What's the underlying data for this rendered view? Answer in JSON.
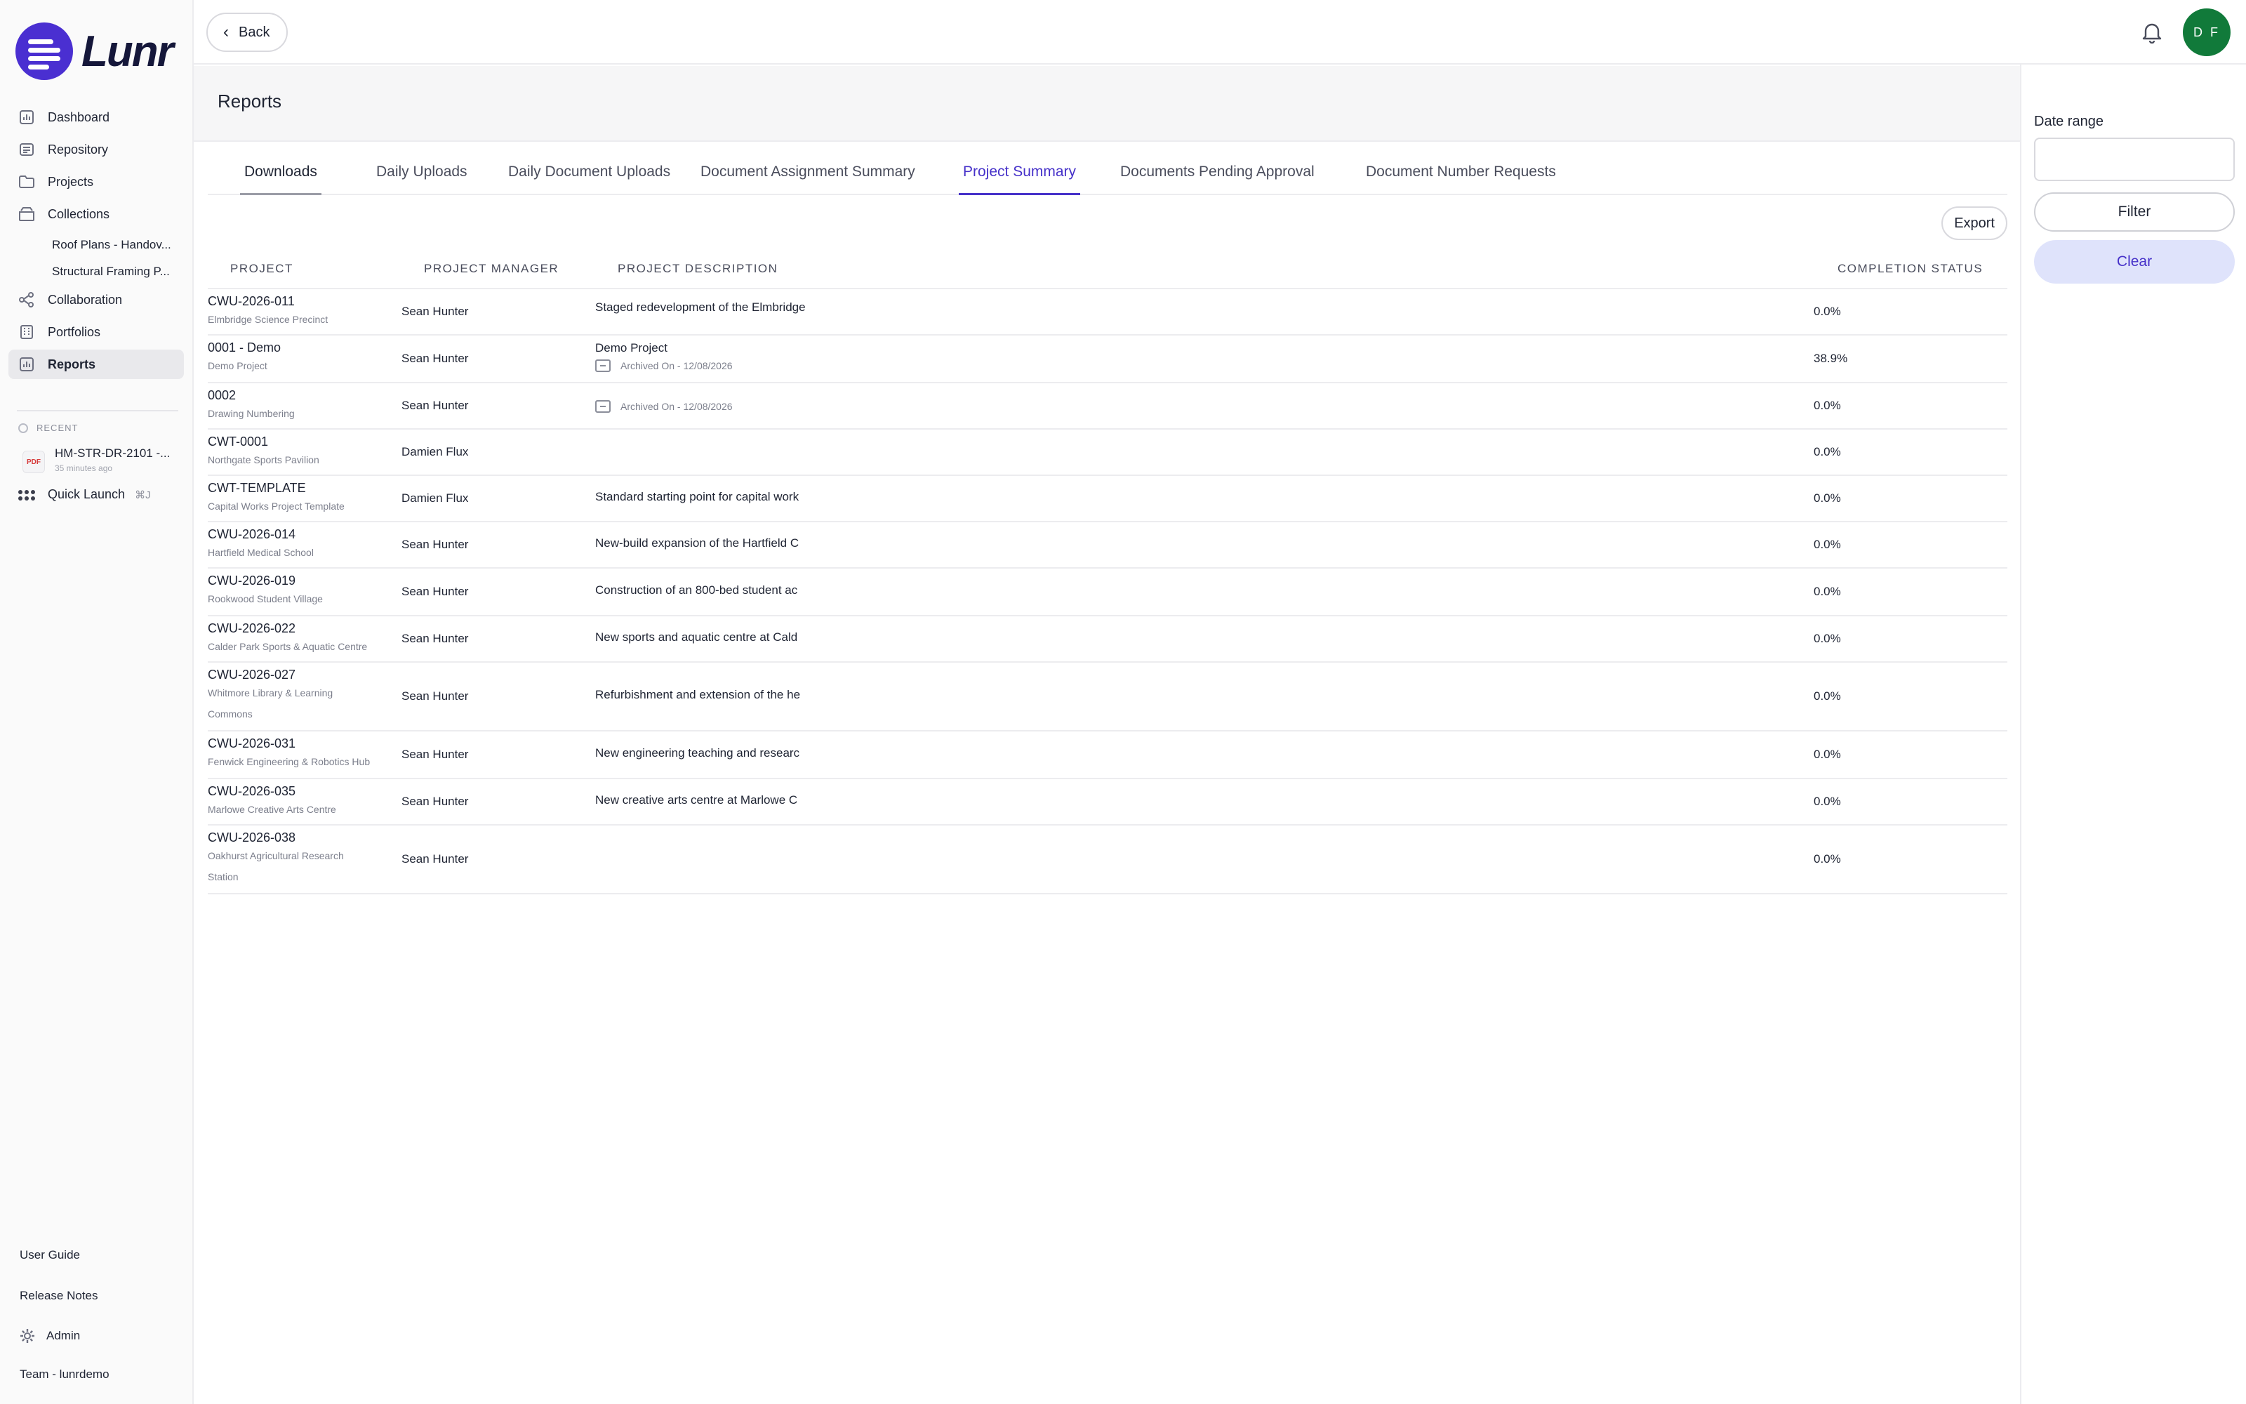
{
  "brand": {
    "name": "Lunr",
    "color": "#4a2fd1"
  },
  "sidebar": {
    "nav": [
      {
        "label": "Dashboard",
        "icon": "dashboard-icon"
      },
      {
        "label": "Repository",
        "icon": "repository-icon"
      },
      {
        "label": "Projects",
        "icon": "folder-icon"
      },
      {
        "label": "Collections",
        "icon": "collections-icon"
      }
    ],
    "collections": [
      "Roof Plans - Handov...",
      "Structural Framing P..."
    ],
    "nav2": [
      {
        "label": "Collaboration",
        "icon": "share-icon"
      },
      {
        "label": "Portfolios",
        "icon": "building-icon"
      },
      {
        "label": "Reports",
        "icon": "chart-icon",
        "active": true
      }
    ],
    "recent_label": "RECENT",
    "recent": {
      "badge": "PDF",
      "name": "HM-STR-DR-2101 -...",
      "time": "35 minutes ago"
    },
    "quick_launch": {
      "label": "Quick Launch",
      "shortcut": "⌘J"
    },
    "footer": {
      "user_guide": "User Guide",
      "release_notes": "Release Notes",
      "admin": "Admin",
      "team": "Team - lunrdemo"
    }
  },
  "topbar": {
    "back_label": "Back",
    "avatar_initials": "D F",
    "avatar_color": "#117a3a"
  },
  "page": {
    "title": "Reports"
  },
  "tabs": [
    {
      "label": "Downloads"
    },
    {
      "label": "Daily Uploads"
    },
    {
      "label": "Daily Document Uploads"
    },
    {
      "label": "Document Assignment Summary"
    },
    {
      "label": "Project Summary",
      "active": true
    },
    {
      "label": "Documents Pending Approval"
    },
    {
      "label": "Document Number Requests"
    }
  ],
  "export_label": "Export",
  "table": {
    "headers": {
      "project": "PROJECT",
      "manager": "PROJECT MANAGER",
      "description": "PROJECT DESCRIPTION",
      "status": "COMPLETION STATUS"
    },
    "rows": [
      {
        "code": "CWU-2026-011",
        "name": "Elmbridge Science Precinct",
        "manager": "Sean Hunter",
        "description": "Staged redevelopment of the Elmbridge",
        "archived": "",
        "status": "0.0%"
      },
      {
        "code": "0001 - Demo",
        "name": "Demo Project",
        "manager": "Sean Hunter",
        "description": "Demo Project",
        "archived": "Archived On - 12/08/2026",
        "status": "38.9%"
      },
      {
        "code": "0002",
        "name": "Drawing Numbering",
        "manager": "Sean Hunter",
        "description": "",
        "archived": "Archived On - 12/08/2026",
        "status": "0.0%"
      },
      {
        "code": "CWT-0001",
        "name": "Northgate Sports Pavilion",
        "manager": "Damien Flux",
        "description": "",
        "archived": "",
        "status": "0.0%"
      },
      {
        "code": "CWT-TEMPLATE",
        "name": "Capital Works Project Template",
        "manager": "Damien Flux",
        "description": "Standard starting point for capital work",
        "archived": "",
        "status": "0.0%"
      },
      {
        "code": "CWU-2026-014",
        "name": "Hartfield Medical School",
        "manager": "Sean Hunter",
        "description": "New-build expansion of the Hartfield C",
        "archived": "",
        "status": "0.0%"
      },
      {
        "code": "CWU-2026-019",
        "name": "Rookwood Student Village",
        "manager": "Sean Hunter",
        "description": "Construction of an 800-bed student ac",
        "archived": "",
        "status": "0.0%"
      },
      {
        "code": "CWU-2026-022",
        "name": "Calder Park Sports & Aquatic Centre",
        "manager": "Sean Hunter",
        "description": "New sports and aquatic centre at Cald",
        "archived": "",
        "status": "0.0%"
      },
      {
        "code": "CWU-2026-027",
        "name": "Whitmore Library & Learning Commons",
        "manager": "Sean Hunter",
        "description": "Refurbishment and extension of the he",
        "archived": "",
        "status": "0.0%"
      },
      {
        "code": "CWU-2026-031",
        "name": "Fenwick Engineering & Robotics Hub",
        "manager": "Sean Hunter",
        "description": "New engineering teaching and researc",
        "archived": "",
        "status": "0.0%"
      },
      {
        "code": "CWU-2026-035",
        "name": "Marlowe Creative Arts Centre",
        "manager": "Sean Hunter",
        "description": "New creative arts centre at Marlowe C",
        "archived": "",
        "status": "0.0%"
      },
      {
        "code": "CWU-2026-038",
        "name": "Oakhurst Agricultural Research Station",
        "manager": "Sean Hunter",
        "description": "",
        "archived": "",
        "status": "0.0%"
      }
    ]
  },
  "filters": {
    "date_range_label": "Date range",
    "date_range_value": "",
    "filter_label": "Filter",
    "clear_label": "Clear"
  }
}
